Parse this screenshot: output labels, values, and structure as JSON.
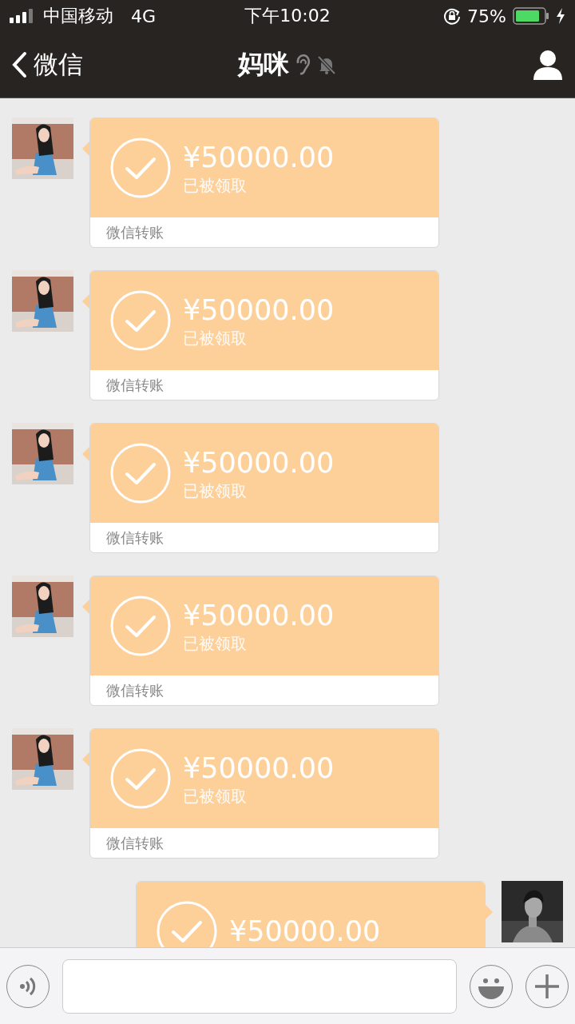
{
  "status_bar": {
    "carrier": "中国移动",
    "network": "4G",
    "time": "下午10:02",
    "battery_percent": "75%"
  },
  "nav_bar": {
    "back_label": "微信",
    "title": "妈咪"
  },
  "messages": [
    {
      "kind": "received",
      "amount": "¥50000.00",
      "status": "已被领取",
      "label": "微信转账"
    },
    {
      "kind": "received",
      "amount": "¥50000.00",
      "status": "已被领取",
      "label": "微信转账"
    },
    {
      "kind": "received",
      "amount": "¥50000.00",
      "status": "已被领取",
      "label": "微信转账"
    },
    {
      "kind": "received",
      "amount": "¥50000.00",
      "status": "已被领取",
      "label": "微信转账"
    },
    {
      "kind": "received",
      "amount": "¥50000.00",
      "status": "已被领取",
      "label": "微信转账"
    },
    {
      "kind": "sent",
      "amount": "¥50000.00"
    }
  ]
}
